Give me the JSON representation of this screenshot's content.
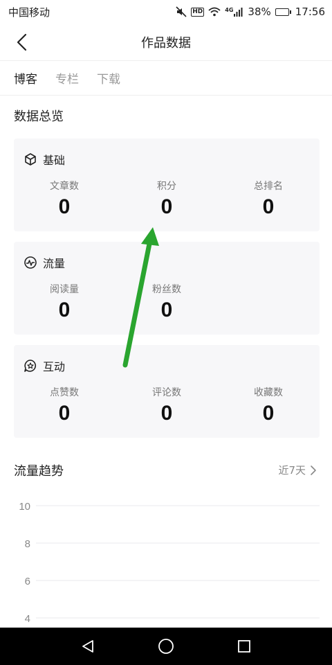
{
  "status_bar": {
    "carrier": "中国移动",
    "network": "4G",
    "battery": "38%",
    "battery_level": 0.38,
    "time": "17:56",
    "icons": [
      "mute-icon",
      "hd-icon",
      "wifi-icon",
      "signal-icon",
      "battery-icon"
    ]
  },
  "nav": {
    "title": "作品数据",
    "back_icon": "chevron-left-icon"
  },
  "tabs": [
    {
      "label": "博客",
      "active": true
    },
    {
      "label": "专栏",
      "active": false
    },
    {
      "label": "下载",
      "active": false
    }
  ],
  "overview": {
    "title": "数据总览",
    "groups": [
      {
        "title": "基础",
        "icon": "cube-icon",
        "metrics": [
          {
            "label": "文章数",
            "value": "0"
          },
          {
            "label": "积分",
            "value": "0"
          },
          {
            "label": "总排名",
            "value": "0"
          }
        ]
      },
      {
        "title": "流量",
        "icon": "pulse-icon",
        "metrics": [
          {
            "label": "阅读量",
            "value": "0"
          },
          {
            "label": "粉丝数",
            "value": "0"
          }
        ]
      },
      {
        "title": "互动",
        "icon": "star-chat-icon",
        "metrics": [
          {
            "label": "点赞数",
            "value": "0"
          },
          {
            "label": "评论数",
            "value": "0"
          },
          {
            "label": "收藏数",
            "value": "0"
          }
        ]
      }
    ]
  },
  "trend": {
    "title": "流量趋势",
    "range_label": "近7天",
    "range_icon": "chevron-right-icon",
    "y_ticks": [
      "10",
      "8",
      "6",
      "4"
    ]
  },
  "colors": {
    "annotation_arrow": "#2aa52f",
    "card_bg": "#f7f7f9",
    "gridline": "#e9e9ee"
  }
}
